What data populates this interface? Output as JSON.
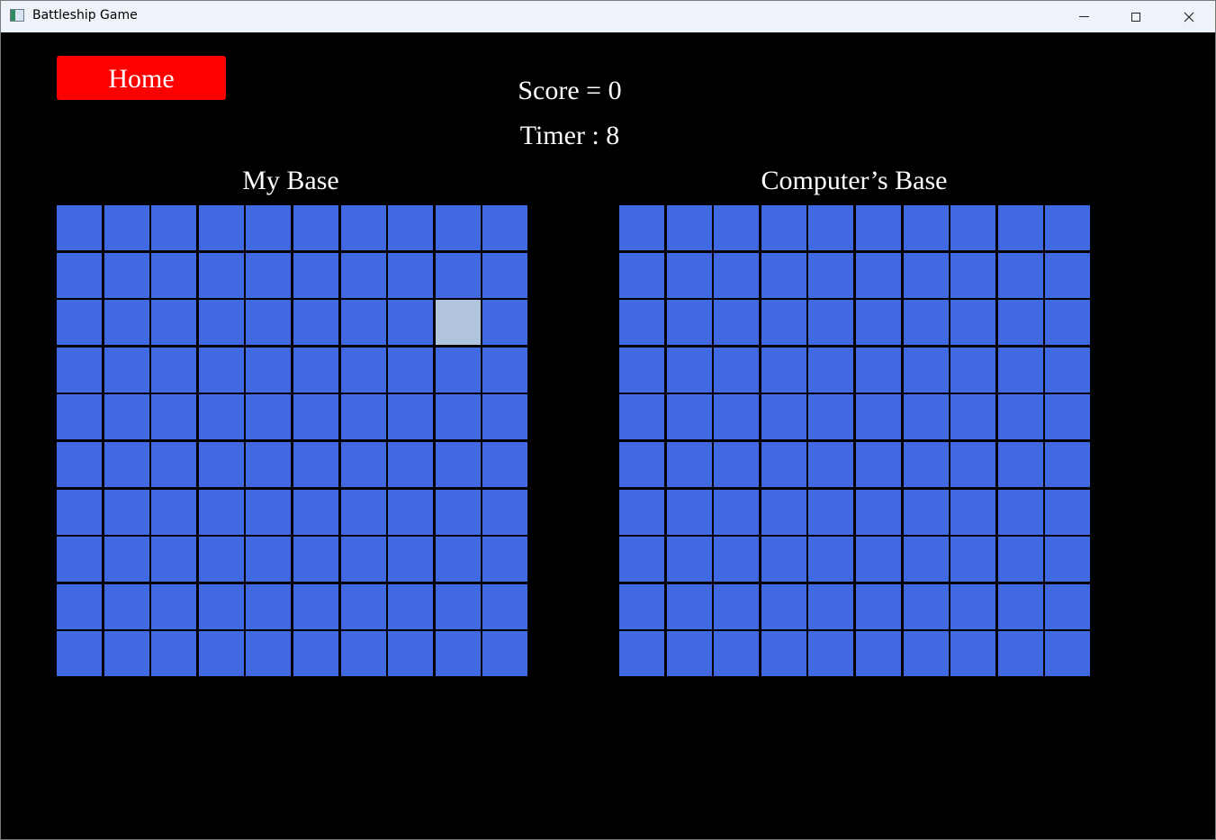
{
  "window": {
    "title": "Battleship Game",
    "controls": {
      "minimize_icon": "minimize-icon",
      "maximize_icon": "maximize-icon",
      "close_icon": "close-icon"
    }
  },
  "game": {
    "home_label": "Home",
    "score_text": "Score = 0",
    "timer_text": "Timer : 8",
    "my_base": {
      "title": "My Base",
      "rows": 10,
      "cols": 10,
      "selected_cell": {
        "row": 3,
        "col": 9
      }
    },
    "computer_base": {
      "title": "Computer’s Base",
      "rows": 10,
      "cols": 10
    }
  },
  "colors": {
    "background": "#000000",
    "home_button": "#ff0000",
    "cell": "#4169e1",
    "cell_selected": "#b0c4de",
    "text": "#ffffff"
  }
}
